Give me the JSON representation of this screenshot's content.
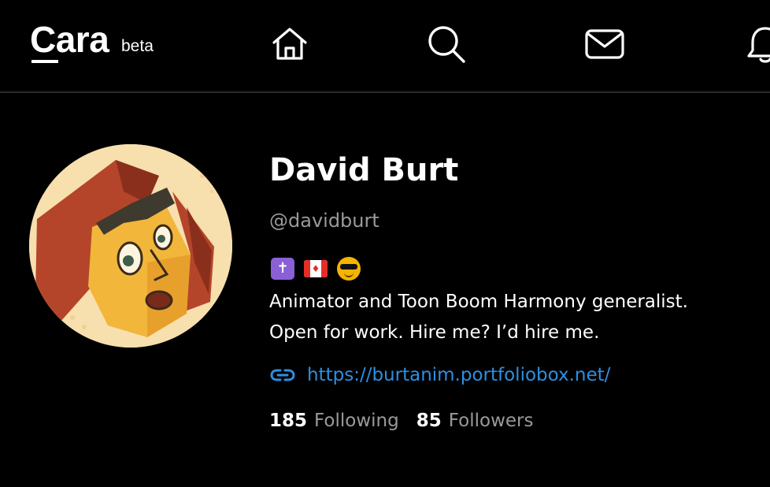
{
  "header": {
    "logo_text": "Cara",
    "logo_badge": "beta",
    "nav": [
      {
        "icon": "home-icon"
      },
      {
        "icon": "search-icon"
      },
      {
        "icon": "mail-icon"
      },
      {
        "icon": "bell-icon"
      }
    ]
  },
  "profile": {
    "display_name": "David Burt",
    "handle": "@davidburt",
    "badges": [
      "latin-cross-emoji",
      "canada-flag-emoji",
      "sunglasses-face-emoji"
    ],
    "bio_lines": [
      "Animator and Toon Boom Harmony generalist.",
      "Open for work. Hire me? I’d hire me."
    ],
    "website": "https://burtanim.portfoliobox.net/",
    "following_count": "185",
    "following_label": "Following",
    "followers_count": "85",
    "followers_label": "Followers"
  },
  "colors": {
    "background": "#000000",
    "text": "#ffffff",
    "muted": "#9a9a9a",
    "link": "#2e8fe0",
    "divider": "#2a2a2a"
  }
}
